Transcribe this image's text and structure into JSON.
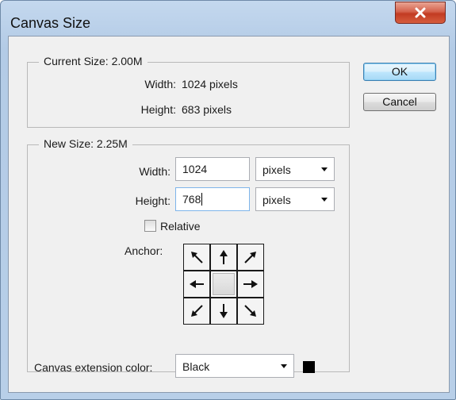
{
  "window": {
    "title": "Canvas Size"
  },
  "current_size": {
    "legend": "Current Size: 2.00M",
    "width_label": "Width:",
    "width_value": "1024 pixels",
    "height_label": "Height:",
    "height_value": "683 pixels"
  },
  "new_size": {
    "legend": "New Size: 2.25M",
    "width_label": "Width:",
    "width_value": "1024",
    "width_unit": "pixels",
    "height_label": "Height:",
    "height_value": "768",
    "height_unit": "pixels",
    "relative_label": "Relative",
    "relative_checked": false,
    "anchor_label": "Anchor:",
    "anchor_selected": "center"
  },
  "extension": {
    "label": "Canvas extension color:",
    "value": "Black",
    "swatch_color": "#000000"
  },
  "buttons": {
    "ok": "OK",
    "cancel": "Cancel"
  },
  "icons": {
    "close": "close-icon",
    "anchor_arrows": [
      "arrow-up-left-icon",
      "arrow-up-icon",
      "arrow-up-right-icon",
      "arrow-left-icon",
      "anchor-center",
      "arrow-right-icon",
      "arrow-down-left-icon",
      "arrow-down-icon",
      "arrow-down-right-icon"
    ]
  },
  "colors": {
    "accent": "#3c7fb1",
    "close_button": "#c23b22"
  }
}
